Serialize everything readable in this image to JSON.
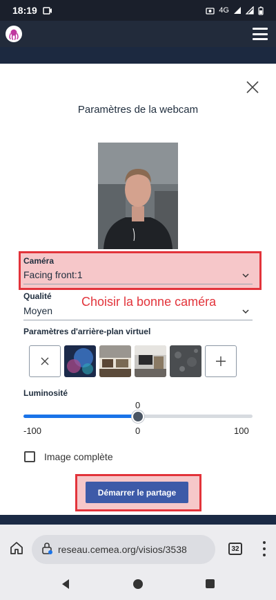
{
  "status": {
    "time": "18:19",
    "network": "4G"
  },
  "modal": {
    "title": "Paramètres de la webcam",
    "camera_label": "Caméra",
    "camera_value": "Facing front:1",
    "annotation": "Choisir la bonne caméra",
    "quality_label": "Qualité",
    "quality_value": "Moyen",
    "background_label": "Paramètres d'arrière-plan virtuel",
    "brightness_label": "Luminosité",
    "brightness_value": "0",
    "brightness_level": 0.5,
    "brightness_min": "-100",
    "brightness_mid": "0",
    "brightness_max": "100",
    "fullimage_label": "Image complète",
    "start_button": "Démarrer le partage"
  },
  "browser": {
    "url": "reseau.cemea.org/visios/3538",
    "tab_count": "32"
  },
  "colors": {
    "accent": "#1a73e8",
    "highlight_border": "#e2333a",
    "button": "#3d5aa8"
  }
}
